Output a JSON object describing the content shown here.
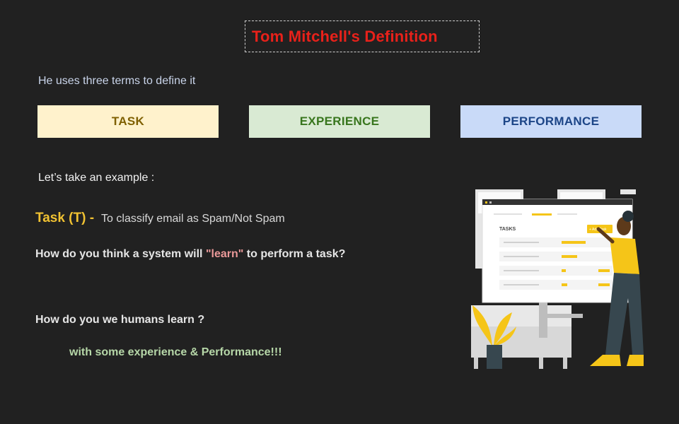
{
  "slide": {
    "title": "Tom Mitchell's Definition",
    "subtitle": "He uses three terms to define it",
    "terms": [
      {
        "label": "TASK",
        "bg": "#fff2cc",
        "color": "#7f6000"
      },
      {
        "label": "EXPERIENCE",
        "bg": "#d9ead3",
        "color": "#38761d"
      },
      {
        "label": "PERFORMANCE",
        "bg": "#c9daf8",
        "color": "#1c4587"
      }
    ],
    "example_heading": "Let’s take an example :",
    "task": {
      "label": "Task (T) -",
      "text": "To classify email as Spam/Not Spam"
    },
    "question1": {
      "before": "How do you think a system will ",
      "highlight": "\"learn\"",
      "after": " to perform a task?"
    },
    "question2": "How do you we humans learn ?",
    "answer": "with some experience & Performance!!!"
  },
  "illustration": {
    "screen_heading": "TASKS",
    "button_label": "+ Add Task",
    "accent_color": "#f5c518"
  }
}
